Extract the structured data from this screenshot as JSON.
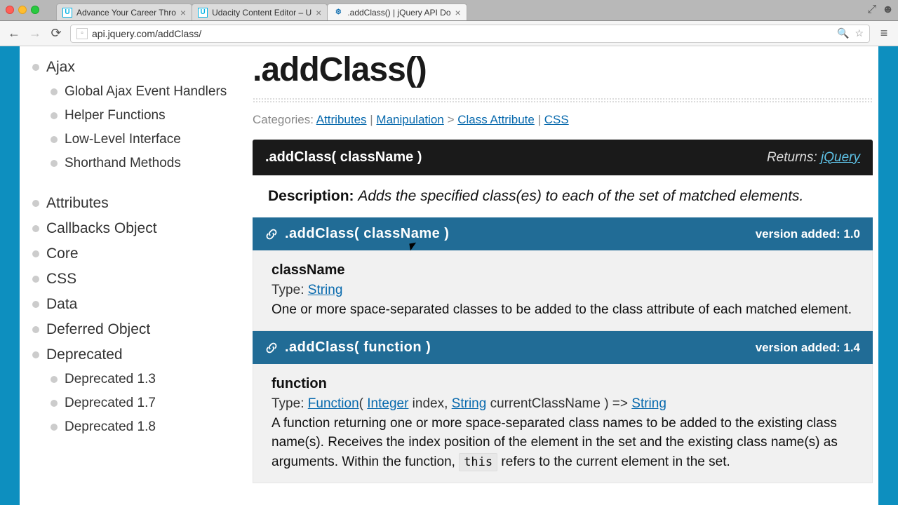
{
  "chrome": {
    "tabs": [
      {
        "title": "Advance Your Career Thro",
        "favicon": "U"
      },
      {
        "title": "Udacity Content Editor – U",
        "favicon": "U"
      },
      {
        "title": ".addClass() | jQuery API Do",
        "favicon": "j"
      }
    ],
    "url": "api.jquery.com/addClass/",
    "active_tab_index": 2
  },
  "sidebar": {
    "items": [
      {
        "label": "Ajax",
        "children": [
          {
            "label": "Global Ajax Event Handlers"
          },
          {
            "label": "Helper Functions"
          },
          {
            "label": "Low-Level Interface"
          },
          {
            "label": "Shorthand Methods"
          }
        ]
      },
      {
        "label": "Attributes"
      },
      {
        "label": "Callbacks Object"
      },
      {
        "label": "Core"
      },
      {
        "label": "CSS"
      },
      {
        "label": "Data"
      },
      {
        "label": "Deferred Object"
      },
      {
        "label": "Deprecated",
        "children": [
          {
            "label": "Deprecated 1.3"
          },
          {
            "label": "Deprecated 1.7"
          },
          {
            "label": "Deprecated 1.8"
          }
        ]
      }
    ]
  },
  "page": {
    "title": ".addClass()",
    "categories_label": "Categories:",
    "categories": [
      "Attributes",
      "Manipulation",
      "Class Attribute",
      "CSS"
    ],
    "method": {
      "signature": ".addClass( className )",
      "returns_label": "Returns:",
      "returns_link": "jQuery",
      "description_label": "Description:",
      "description_text": "Adds the specified class(es) to each of the set of matched elements.",
      "variants": [
        {
          "signature": ".addClass( className )",
          "version_label": "version added: 1.0",
          "param_name": "className",
          "type_label": "Type:",
          "type_link": "String",
          "param_desc": "One or more space-separated classes to be added to the class attribute of each matched element."
        },
        {
          "signature": ".addClass( function )",
          "version_label": "version added: 1.4",
          "param_name": "function",
          "type_label": "Type:",
          "type_link1": "Function",
          "type_plain1": "( ",
          "type_link2": "Integer",
          "type_plain2": " index, ",
          "type_link3": "String",
          "type_plain3": " currentClassName ) => ",
          "type_link4": "String",
          "param_desc1": "A function returning one or more space-separated class names to be added to the existing class name(s). Receives the index position of the element in the set and the existing class name(s) as arguments. Within the function, ",
          "param_code": "this",
          "param_desc2": " refers to the current element in the set."
        }
      ]
    }
  }
}
